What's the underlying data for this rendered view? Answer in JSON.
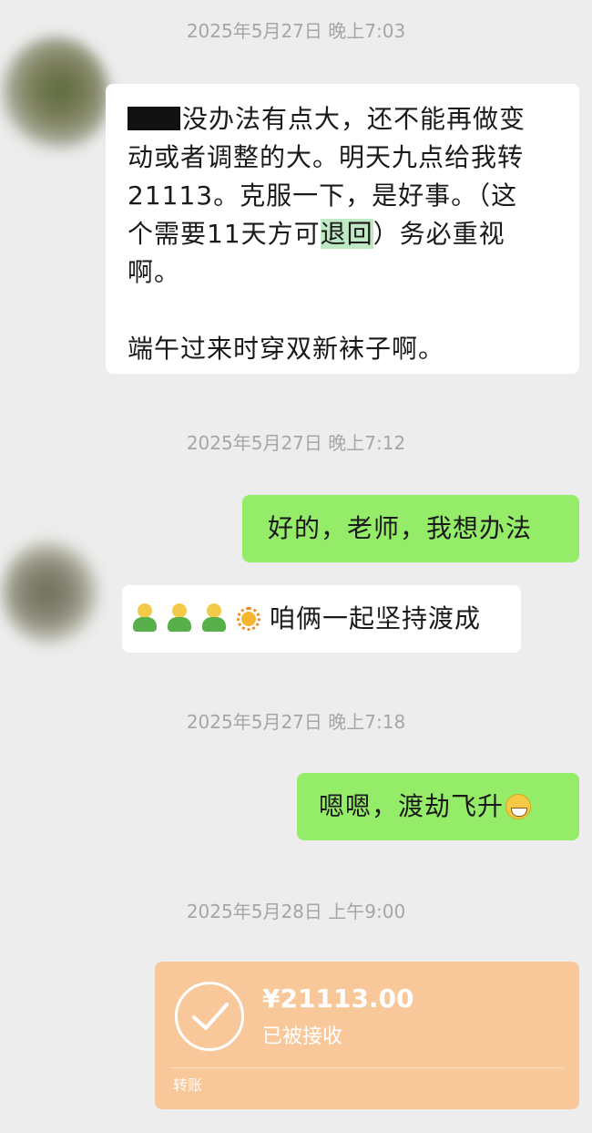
{
  "messages": [
    {
      "timestamp": "2025年5月27日 晚上7:03"
    },
    {
      "msg1": {
        "line1": "没办法有点大，还不能再做变",
        "line2": "动或者调整的大。明天九点给我转",
        "line3": "21113。克服一下，是好事。（这",
        "line4a": "个需要11天方可",
        "line4hl": "退回",
        "line4b": "）务必重视",
        "line5": "啊。",
        "line7": "端午过来时穿双新袜子啊。"
      }
    }
  ],
  "timestamps": {
    "t1": "2025年5月27日 晚上7:03",
    "t2": "2025年5月27日 晚上7:12",
    "t3": "2025年5月27日 晚上7:18",
    "t4": "2025年5月28日 上午9:00"
  },
  "bubble_reply1": "好的，老师，我想办法",
  "bubble_left2": "咱俩一起坚持渡成",
  "bubble_reply2": "嗯嗯，渡劫飞升",
  "transfer": {
    "amount": "¥21113.00",
    "status": "已被接收",
    "type": "转账"
  },
  "colors": {
    "background": "#ededed",
    "sent_bubble": "#95ec69",
    "received_bubble": "#ffffff",
    "transfer_card": "#f8c89a"
  }
}
